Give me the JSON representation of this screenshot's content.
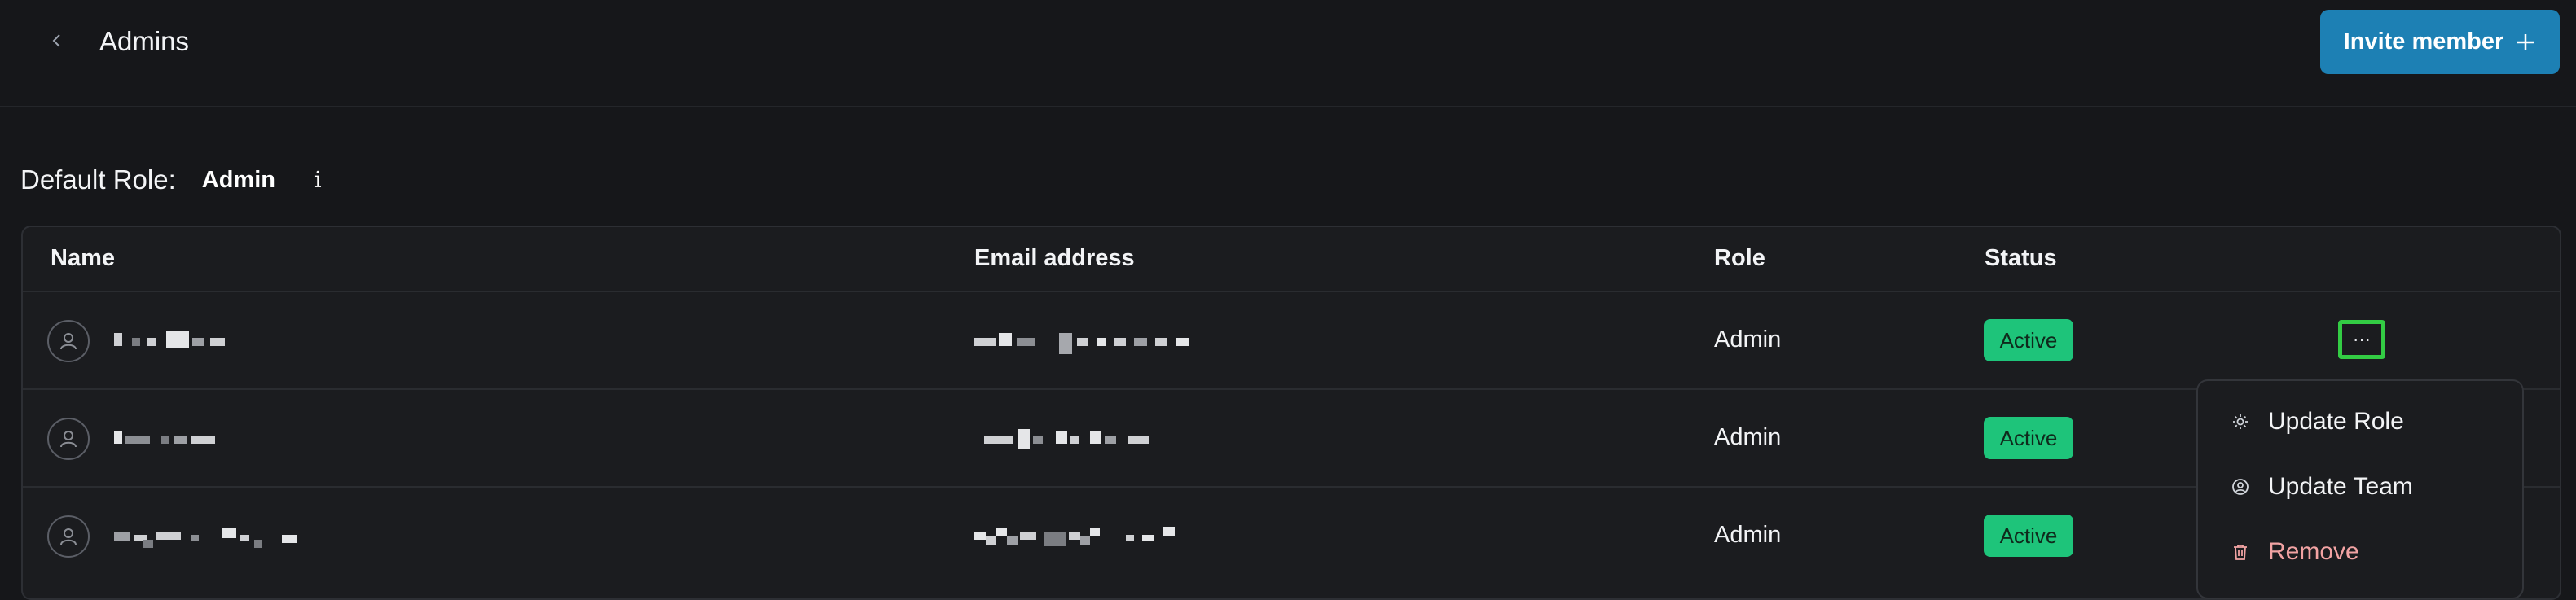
{
  "header": {
    "title": "Admins",
    "invite_label": "Invite member",
    "invite_icon": "plus-icon",
    "back_icon": "chevron-left-icon"
  },
  "default_role": {
    "label": "Default Role:",
    "value": "Admin",
    "info_label": "i"
  },
  "table": {
    "columns": [
      "Name",
      "Email address",
      "Role",
      "Status"
    ],
    "rows": [
      {
        "role": "Admin",
        "status": "Active"
      },
      {
        "role": "Admin",
        "status": "Active"
      },
      {
        "role": "Admin",
        "status": "Active"
      }
    ],
    "more_label": "···"
  },
  "row_menu": {
    "items": [
      {
        "label": "Update Role",
        "icon": "gear-icon"
      },
      {
        "label": "Update Team",
        "icon": "user-circle-icon"
      },
      {
        "label": "Remove",
        "icon": "trash-icon"
      }
    ]
  },
  "colors": {
    "background": "#16171a",
    "accent": "#1d80b4",
    "status_active": "#1ec47a",
    "danger": "#f2a3a3",
    "focus_outline": "#33cc44"
  }
}
